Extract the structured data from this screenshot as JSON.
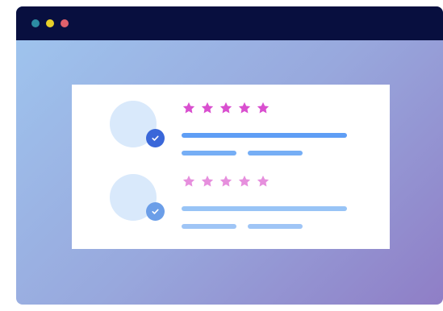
{
  "window": {
    "titlebar_color": "#080f3f",
    "dots": [
      {
        "color": "#2c8ca3"
      },
      {
        "color": "#e8cf29"
      },
      {
        "color": "#e0616c"
      }
    ]
  },
  "reviews": [
    {
      "avatar_icon": "avatar-circle",
      "badge_icon": "check-circle-icon",
      "badge_color": "#3a67d9",
      "star_color": "#d94fcf",
      "rating": 5,
      "bar_color": "#5f9ef5",
      "small_bar_color": "#76aef5"
    },
    {
      "avatar_icon": "avatar-circle",
      "badge_icon": "check-circle-icon",
      "badge_color": "#6b9ee8",
      "star_color": "#e68fdd",
      "rating": 5,
      "bar_color": "#98c4f6",
      "small_bar_color": "#9fc5f6"
    }
  ]
}
